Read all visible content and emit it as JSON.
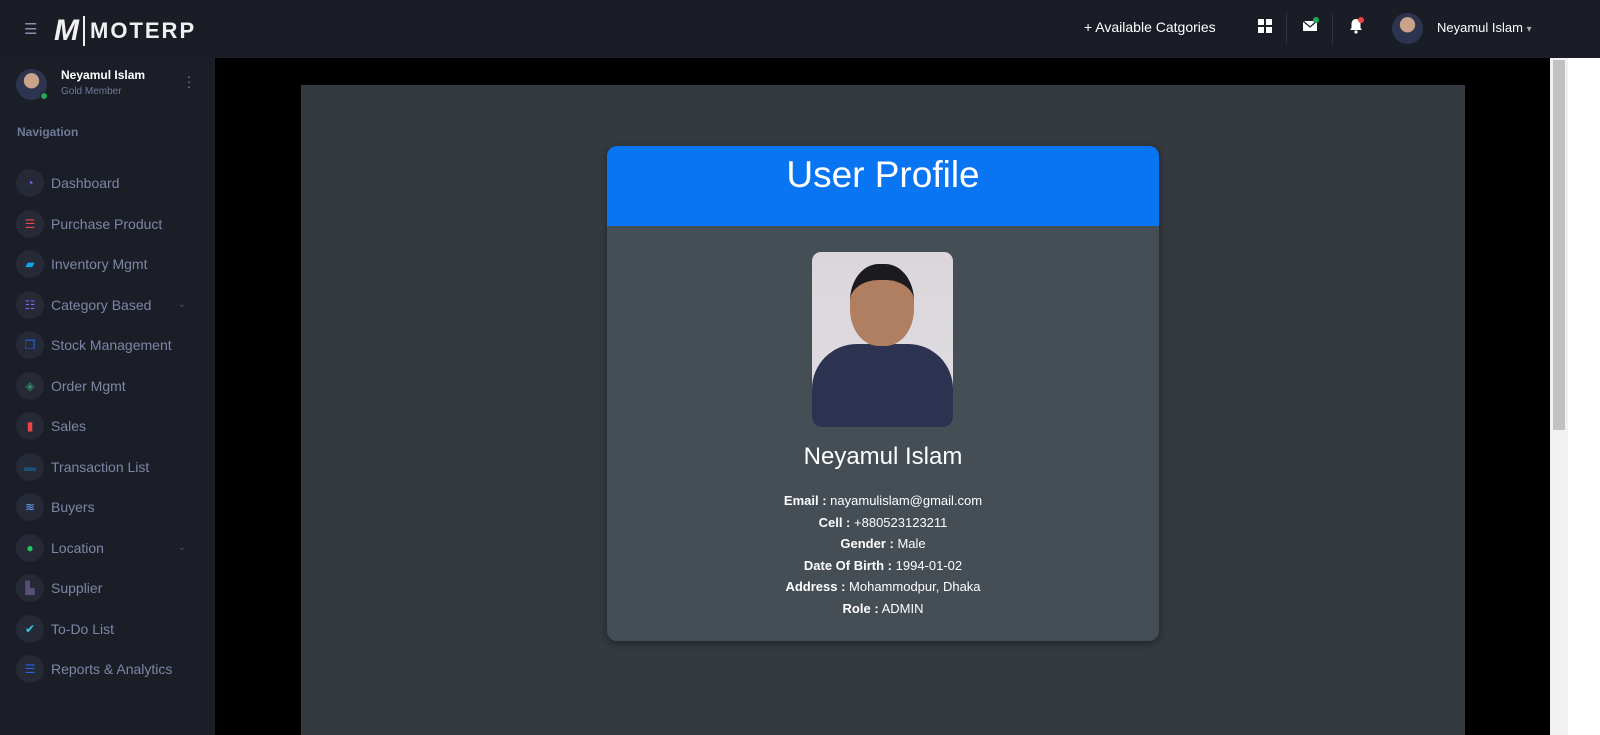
{
  "topbar": {
    "brand_mark": "M",
    "brand_text": "MOTERP",
    "available_categories": "+ Available Catgories",
    "user_name": "Neyamul Islam",
    "caret": "▾"
  },
  "sidebar": {
    "user_name": "Neyamul Islam",
    "user_role": "Gold Member",
    "nav_heading": "Navigation",
    "items": [
      {
        "label": "Dashboard",
        "icon": "gauge-icon",
        "color": "#8b5cf6",
        "glyph": "◔"
      },
      {
        "label": "Purchase Product",
        "icon": "list-icon",
        "color": "#ef4444",
        "glyph": "☰"
      },
      {
        "label": "Inventory Mgmt",
        "icon": "scroll-icon",
        "color": "#0ea5e9",
        "glyph": "▰"
      },
      {
        "label": "Category Based",
        "icon": "tasks-icon",
        "color": "#8b5cf6",
        "glyph": "☷",
        "chev": "⌄"
      },
      {
        "label": "Stock Management",
        "icon": "clone-icon",
        "color": "#2563eb",
        "glyph": "❐"
      },
      {
        "label": "Order Mgmt",
        "icon": "layers-icon",
        "color": "#2f8a6a",
        "glyph": "◈"
      },
      {
        "label": "Sales",
        "icon": "bar-chart-icon",
        "color": "#ef4444",
        "glyph": "▮"
      },
      {
        "label": "Transaction List",
        "icon": "money-bill-icon",
        "color": "#1e4f7a",
        "glyph": "▬"
      },
      {
        "label": "Buyers",
        "icon": "wind-icon",
        "color": "#60a5fa",
        "glyph": "≋"
      },
      {
        "label": "Location",
        "icon": "globe-icon",
        "color": "#22c55e",
        "glyph": "●",
        "chev": "⌄"
      },
      {
        "label": "Supplier",
        "icon": "industry-icon",
        "color": "#5b4f7a",
        "glyph": "▙"
      },
      {
        "label": "To-Do List",
        "icon": "check-circle-icon",
        "color": "#22d3ee",
        "glyph": "✔"
      },
      {
        "label": "Reports & Analytics",
        "icon": "server-icon",
        "color": "#2563eb",
        "glyph": "☰"
      }
    ]
  },
  "profile": {
    "title": "User Profile",
    "name": "Neyamul Islam",
    "fields": [
      {
        "label": "Email :",
        "value": "nayamulislam@gmail.com"
      },
      {
        "label": "Cell :",
        "value": "+880523123211"
      },
      {
        "label": "Gender :",
        "value": "Male"
      },
      {
        "label": "Date Of Birth :",
        "value": "1994-01-02"
      },
      {
        "label": "Address :",
        "value": "Mohammodpur, Dhaka"
      },
      {
        "label": "Role :",
        "value": "ADMIN"
      }
    ]
  }
}
